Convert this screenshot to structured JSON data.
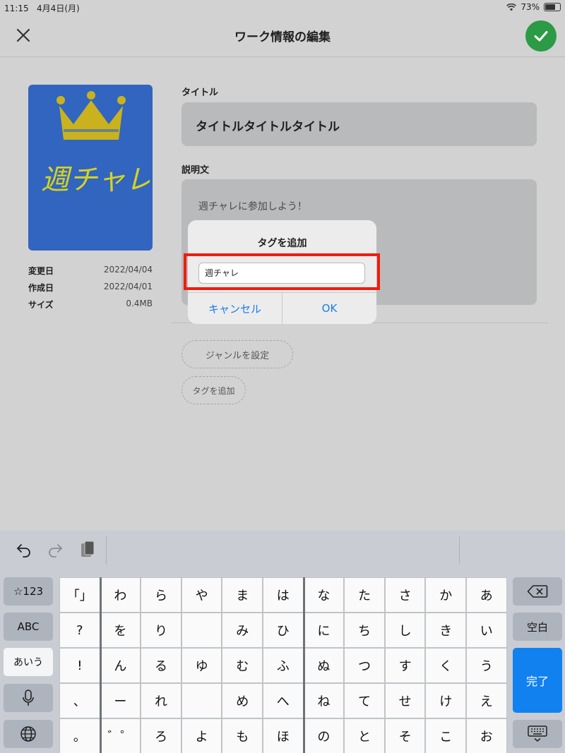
{
  "status_bar": {
    "time": "11:15",
    "date": "4月4日(月)",
    "battery": "73%",
    "wifi_icon": "wifi-icon"
  },
  "nav": {
    "title": "ワーク情報の編集",
    "close_icon": "close-icon",
    "done_icon": "checkmark-icon",
    "accent": "#2d9a46"
  },
  "cover": {
    "text": "週チャレ",
    "crown_icon": "crown-icon",
    "bg": "#3165c0"
  },
  "meta": [
    {
      "key": "変更日",
      "value": "2022/04/04"
    },
    {
      "key": "作成日",
      "value": "2022/04/01"
    },
    {
      "key": "サイズ",
      "value": "0.4MB"
    }
  ],
  "form": {
    "title_label": "タイトル",
    "title_value": "タイトルタイトルタイトル",
    "desc_label": "説明文",
    "desc_value": "週チャレに参加しよう！"
  },
  "chips": {
    "genre": "ジャンルを設定",
    "tag": "タグを追加"
  },
  "dialog": {
    "title": "タグを追加",
    "input_value": "週チャレ",
    "cancel": "キャンセル",
    "ok": "OK",
    "accent": "#1b7bea",
    "highlight_color": "#f11c0e"
  },
  "keyboard": {
    "left_keys": [
      "☆123",
      "ABC",
      "あいう"
    ],
    "mic_icon": "microphone-icon",
    "globe_icon": "globe-icon",
    "right_keys": {
      "space": "空白",
      "done": "完了"
    },
    "backspace_icon": "backspace-icon",
    "dismiss_icon": "keyboard-dismiss-icon",
    "toolbar": {
      "undo_icon": "undo-icon",
      "redo_icon": "redo-icon",
      "paste_icon": "paste-icon"
    },
    "rows": [
      [
        "「」",
        "わ",
        "ら",
        "や",
        "ま",
        "は",
        "な",
        "た",
        "さ",
        "か",
        "あ"
      ],
      [
        "?",
        "を",
        "り",
        "",
        "み",
        "ひ",
        "に",
        "ち",
        "し",
        "き",
        "い"
      ],
      [
        "!",
        "ん",
        "る",
        "ゆ",
        "む",
        "ふ",
        "ぬ",
        "つ",
        "す",
        "く",
        "う"
      ],
      [
        "、",
        "ー",
        "れ",
        "",
        "め",
        "へ",
        "ね",
        "て",
        "せ",
        "け",
        "え"
      ],
      [
        "。",
        "゛゜",
        "ろ",
        "よ",
        "も",
        "ほ",
        "の",
        "と",
        "そ",
        "こ",
        "お"
      ]
    ]
  }
}
